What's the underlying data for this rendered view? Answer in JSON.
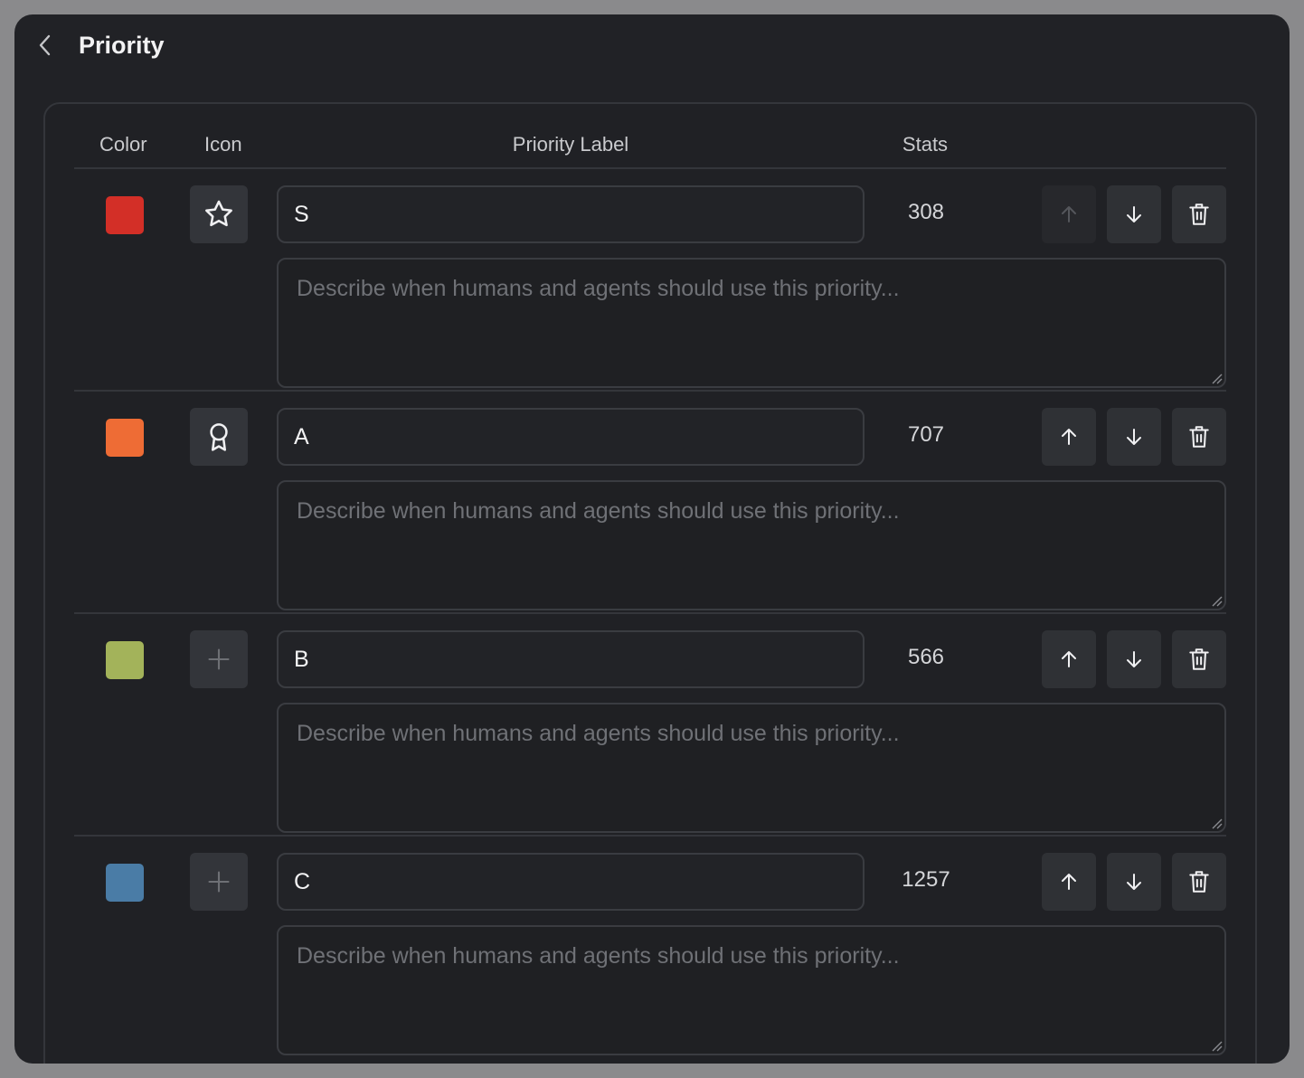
{
  "header": {
    "title": "Priority",
    "back_icon": "chevron-left-icon"
  },
  "table": {
    "columns": {
      "color": "Color",
      "icon": "Icon",
      "label": "Priority Label",
      "stats": "Stats"
    }
  },
  "rows": [
    {
      "color": "#d32f27",
      "icon": "star-icon",
      "label": "S",
      "stats": "308",
      "description": "",
      "description_placeholder": "Describe when humans and agents should use this priority...",
      "move_up_enabled": false
    },
    {
      "color": "#ee6c35",
      "icon": "award-icon",
      "label": "A",
      "stats": "707",
      "description": "",
      "description_placeholder": "Describe when humans and agents should use this priority...",
      "move_up_enabled": true
    },
    {
      "color": "#a3b35a",
      "icon": "plus-icon",
      "label": "B",
      "stats": "566",
      "description": "",
      "description_placeholder": "Describe when humans and agents should use this priority...",
      "move_up_enabled": true
    },
    {
      "color": "#4a7ca6",
      "icon": "plus-icon",
      "label": "C",
      "stats": "1257",
      "description": "",
      "description_placeholder": "Describe when humans and agents should use this priority...",
      "move_up_enabled": true
    }
  ],
  "icons": {
    "move_up": "arrow-up-icon",
    "move_down": "arrow-down-icon",
    "delete": "trash-icon",
    "resize": "resize-grip-icon"
  }
}
